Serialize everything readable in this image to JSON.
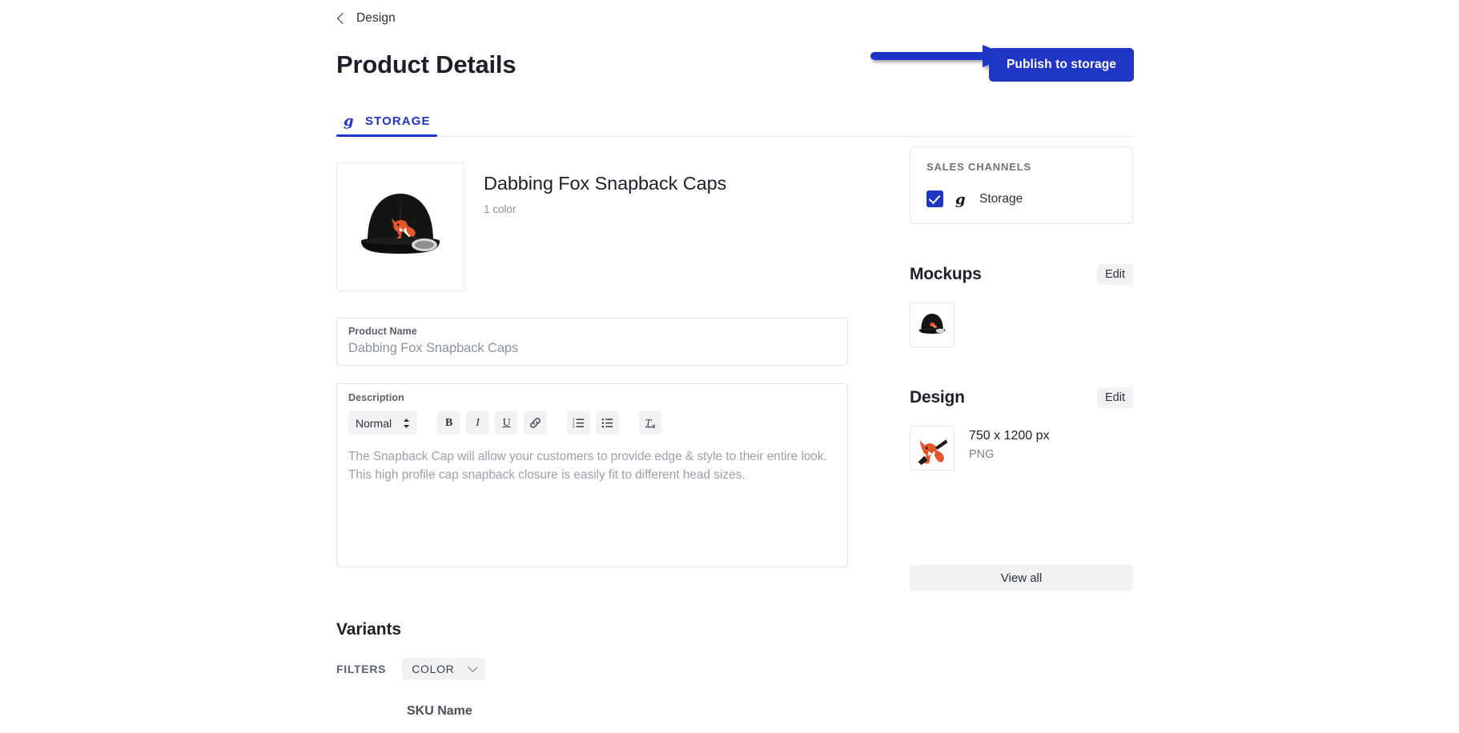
{
  "breadcrumb": {
    "label": "Design",
    "icon": "chevron-left-icon"
  },
  "header": {
    "title": "Product Details",
    "publish_label": "Publish to storage",
    "accent_color": "#1f35c4"
  },
  "annotation": {
    "type": "arrow",
    "color": "#1f35c4",
    "points_to": "Publish to storage"
  },
  "tabs": [
    {
      "label": "STORAGE",
      "icon": "storage-g-logo-icon",
      "active": true
    }
  ],
  "product": {
    "name": "Dabbing Fox Snapback Caps",
    "subtitle": "1 color",
    "thumbnail_alt": "black-snapback-cap-with-dabbing-fox"
  },
  "product_name_field": {
    "label": "Product Name",
    "value": "Dabbing Fox Snapback Caps",
    "placeholder": "Product Name"
  },
  "description": {
    "label": "Description",
    "text": "The Snapback Cap will allow your customers to provide edge & style to their entire look. This high profile cap snapback closure is easily fit to different head sizes.",
    "placeholder": "Description",
    "toolbar": {
      "style_select": "Normal",
      "buttons": [
        {
          "name": "bold-button",
          "glyph": "B"
        },
        {
          "name": "italic-button",
          "glyph": "I"
        },
        {
          "name": "underline-button",
          "glyph": "U"
        },
        {
          "name": "link-button",
          "glyph": "link-icon"
        },
        {
          "name": "ordered-list-button",
          "glyph": "ordered-list-icon"
        },
        {
          "name": "bullet-list-button",
          "glyph": "bullet-list-icon"
        },
        {
          "name": "clear-format-button",
          "glyph": "clear-format-icon"
        }
      ]
    }
  },
  "variants": {
    "title": "Variants",
    "filters_label": "FILTERS",
    "filter_chip": "COLOR",
    "table_headers": [
      "SKU Name"
    ]
  },
  "sales_channels": {
    "title": "SALES CHANNELS",
    "items": [
      {
        "label": "Storage",
        "checked": true,
        "icon": "storage-g-logo-icon"
      }
    ]
  },
  "mockups": {
    "title": "Mockups",
    "edit_label": "Edit",
    "items": [
      {
        "alt": "black-snapback-cap-mockup"
      }
    ]
  },
  "design": {
    "title": "Design",
    "edit_label": "Edit",
    "dimensions": "750 x 1200 px",
    "format": "PNG",
    "thumbnail_alt": "dabbing-fox-artwork"
  },
  "view_all": {
    "label": "View all"
  }
}
